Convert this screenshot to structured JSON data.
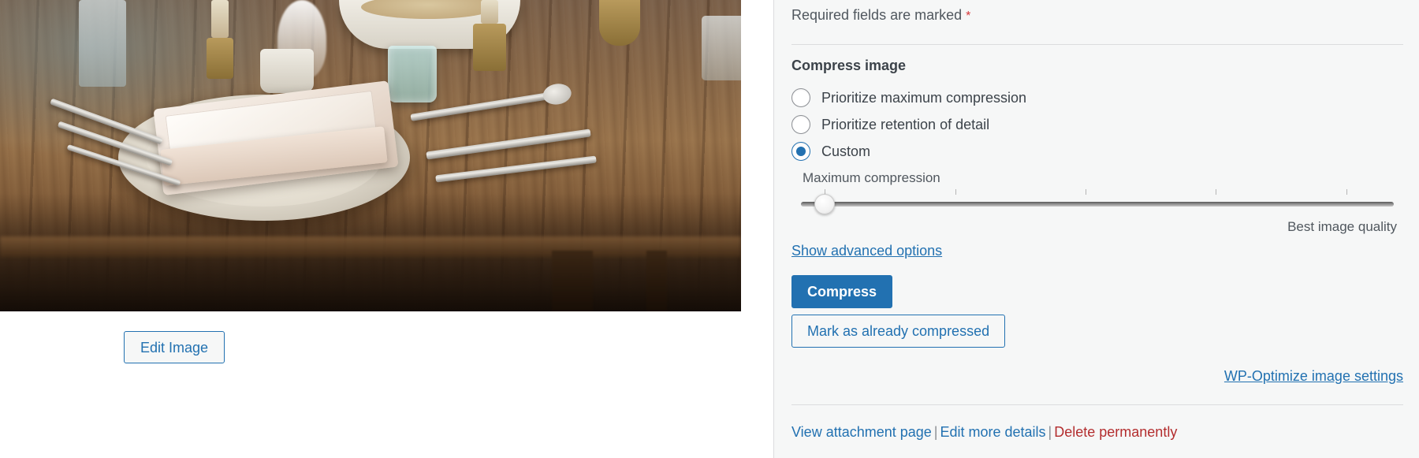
{
  "left": {
    "thumbnail_alt": "rustic wooden table set with plate, folded napkin and cutlery",
    "edit_image_label": "Edit Image"
  },
  "panel": {
    "required_note": "Required fields are marked",
    "required_marker": "*",
    "section_title": "Compress image",
    "radio_options": [
      {
        "label": "Prioritize maximum compression",
        "checked": false
      },
      {
        "label": "Prioritize retention of detail",
        "checked": false
      },
      {
        "label": "Custom",
        "checked": true
      }
    ],
    "slider": {
      "min_label": "Maximum compression",
      "max_label": "Best image quality",
      "value_percent": 4,
      "tick_positions_percent": [
        4,
        26,
        48,
        70,
        92
      ]
    },
    "advanced_link": "Show advanced options",
    "compress_button": "Compress",
    "mark_button": "Mark as already compressed",
    "settings_link": "WP-Optimize image settings",
    "bottom_links": {
      "view": "View attachment page",
      "edit": "Edit more details",
      "delete": "Delete permanently",
      "separator": "|"
    }
  },
  "colors": {
    "panel_bg": "#f6f7f7",
    "accent_blue": "#2271b1",
    "danger_red": "#b32d2e",
    "required_red": "#d63638",
    "divider": "#dcdcde",
    "text": "#3c434a"
  }
}
